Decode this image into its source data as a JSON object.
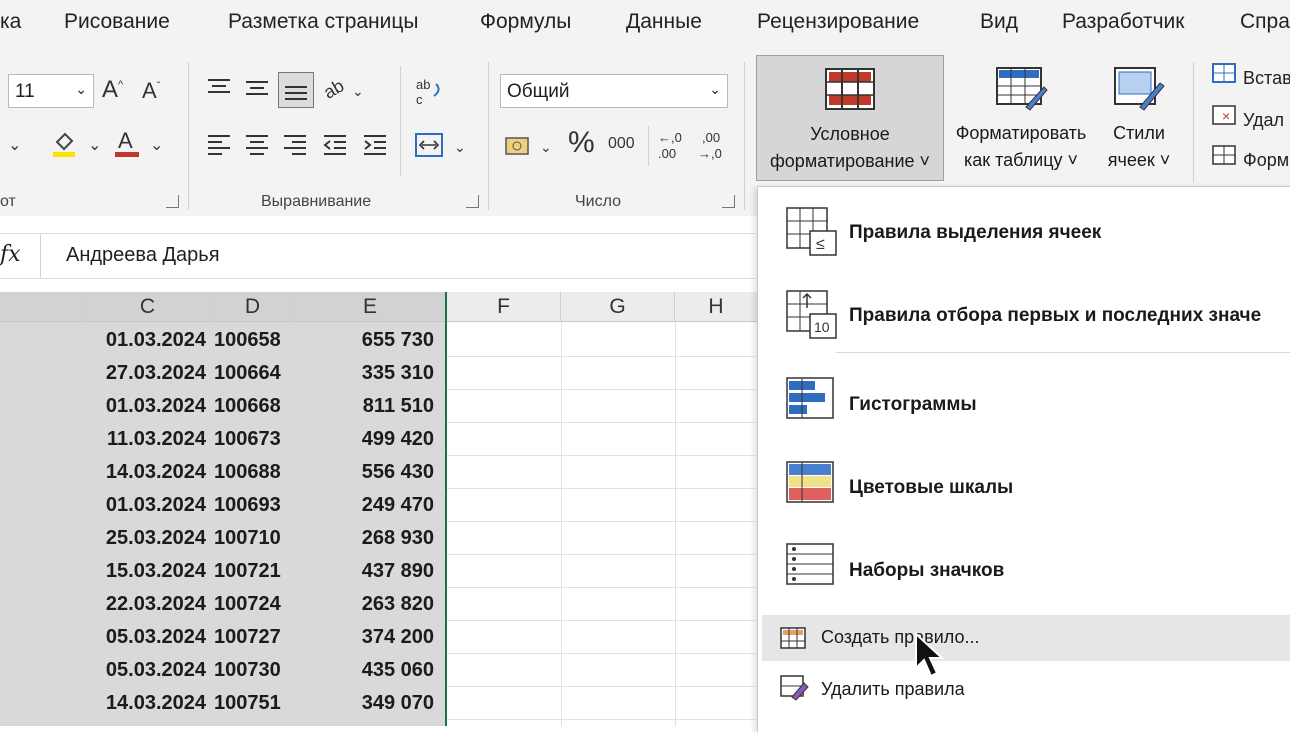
{
  "tabs": [
    "ка",
    "Рисование",
    "Разметка страницы",
    "Формулы",
    "Данные",
    "Рецензирование",
    "Вид",
    "Разработчик",
    "Спра"
  ],
  "ribbon": {
    "font_size": "11",
    "group_font_label": "от",
    "group_align_label": "Выравнивание",
    "group_number_label": "Число",
    "number_format": "Общий",
    "percent_symbol": "%",
    "thousands_symbol": "000",
    "dec_inc": "←,0\n.00",
    "dec_dec": ",00\n→,0",
    "cond_format": [
      "Условное",
      "форматирование ˅"
    ],
    "format_table": [
      "Форматировать",
      "как таблицу ˅"
    ],
    "cell_styles": [
      "Стили",
      "ячеек ˅"
    ],
    "cells_insert": "Встав",
    "cells_delete": "Удал",
    "cells_format": "Форм"
  },
  "formula_bar": {
    "fx": "fx",
    "value": "Андреева Дарья"
  },
  "grid": {
    "columns": [
      "C",
      "D",
      "E",
      "F",
      "G",
      "H"
    ],
    "rows": [
      {
        "date": "01.03.2024",
        "id": "100658",
        "amount": "655 730"
      },
      {
        "date": "27.03.2024",
        "id": "100664",
        "amount": "335 310"
      },
      {
        "date": "01.03.2024",
        "id": "100668",
        "amount": "811 510"
      },
      {
        "date": "11.03.2024",
        "id": "100673",
        "amount": "499 420"
      },
      {
        "date": "14.03.2024",
        "id": "100688",
        "amount": "556 430"
      },
      {
        "date": "01.03.2024",
        "id": "100693",
        "amount": "249 470"
      },
      {
        "date": "25.03.2024",
        "id": "100710",
        "amount": "268 930"
      },
      {
        "date": "15.03.2024",
        "id": "100721",
        "amount": "437 890"
      },
      {
        "date": "22.03.2024",
        "id": "100724",
        "amount": "263 820"
      },
      {
        "date": "05.03.2024",
        "id": "100727",
        "amount": "374 200"
      },
      {
        "date": "05.03.2024",
        "id": "100730",
        "amount": "435 060"
      },
      {
        "date": "14.03.2024",
        "id": "100751",
        "amount": "349 070"
      }
    ]
  },
  "menu": {
    "items": [
      "Правила выделения ячеек",
      "Правила отбора первых и последних значе",
      "Гистограммы",
      "Цветовые шкалы",
      "Наборы значков"
    ],
    "new_rule": "Создать правило...",
    "delete_rules": "Удалить правила",
    "icon_top10_text": "10"
  },
  "colors": {
    "accent_red": "#c0392b",
    "accent_blue": "#2f6ebf",
    "selection_gray": "#d9d9d9",
    "highlight_row": "#e6e6e6"
  }
}
